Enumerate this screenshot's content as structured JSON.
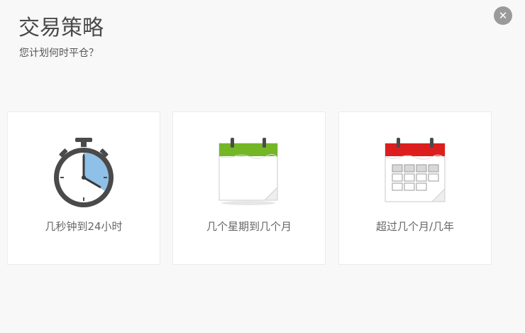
{
  "header": {
    "title": "交易策略",
    "subtitle": "您计划何时平仓？",
    "close_glyph": "✕"
  },
  "cards": [
    {
      "label": "几秒钟到24小时",
      "icon": "stopwatch-icon",
      "accent": "#8fc0e8"
    },
    {
      "label": "几个星期到几个月",
      "icon": "calendar-blank-icon",
      "accent": "#74b626"
    },
    {
      "label": "超过几个月/几年",
      "icon": "calendar-grid-icon",
      "accent": "#dd1e1e"
    }
  ]
}
